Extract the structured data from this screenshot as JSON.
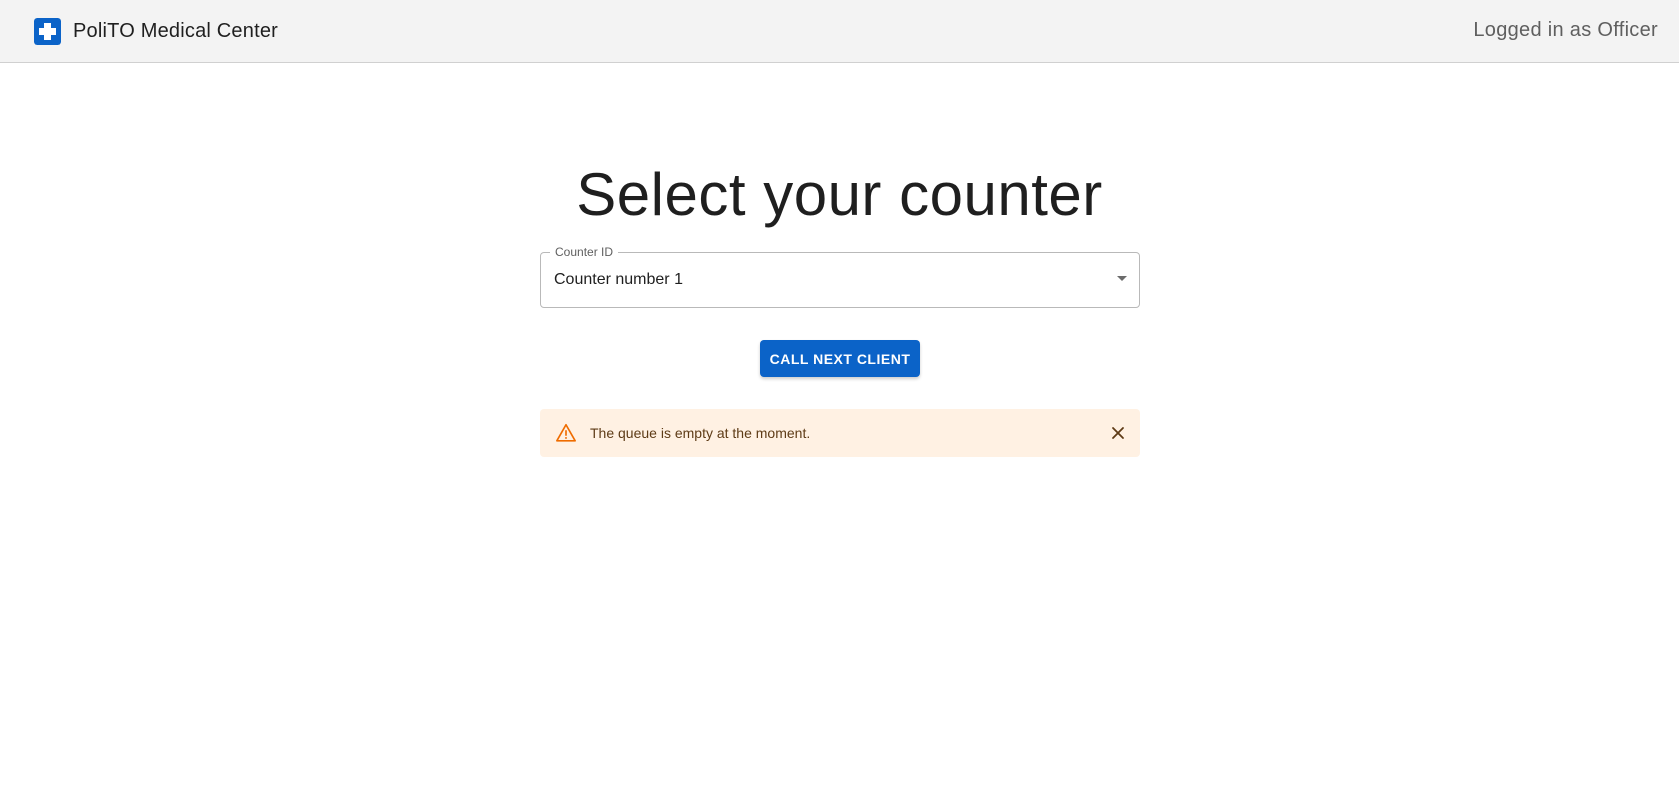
{
  "header": {
    "brand_name": "PoliTO Medical Center",
    "user_status": "Logged in as Officer"
  },
  "main": {
    "title": "Select your counter",
    "counter_select": {
      "label": "Counter ID",
      "value": "Counter number 1"
    },
    "call_button_label": "CALL NEXT CLIENT",
    "alert": {
      "severity": "warning",
      "message": "The queue is empty at the moment."
    }
  },
  "colors": {
    "primary": "#0b63c8",
    "alert_background": "#fff1e3",
    "alert_icon": "#ef6c00",
    "header_background": "#f3f3f3"
  },
  "icons": {
    "logo": "medical-cross-icon",
    "alert": "warning-triangle-icon",
    "close": "close-icon",
    "select": "caret-down-icon"
  }
}
